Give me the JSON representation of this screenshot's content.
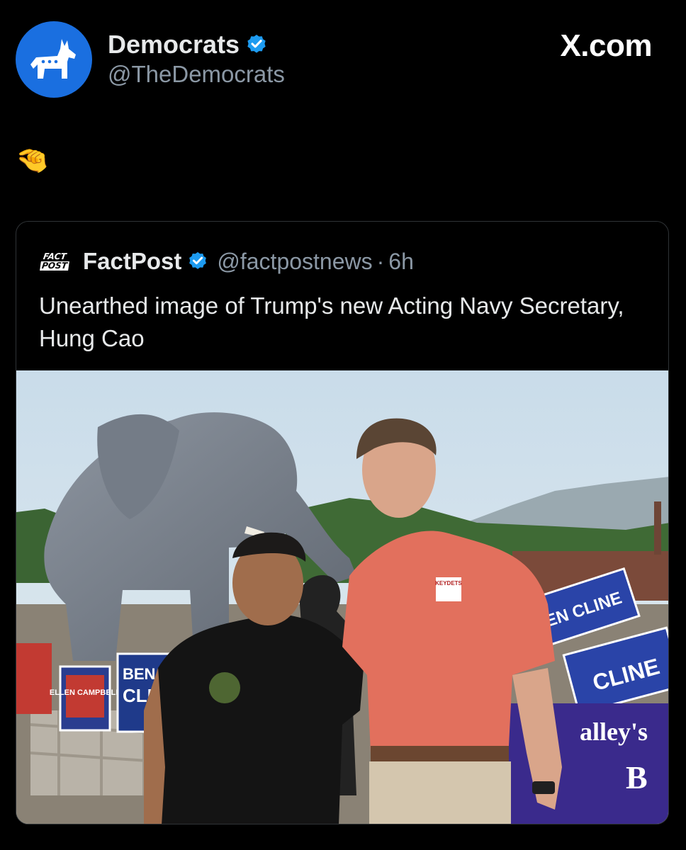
{
  "post": {
    "author": {
      "name": "Democrats",
      "handle": "@TheDemocrats",
      "verified": true,
      "avatar_icon": "donkey-icon",
      "avatar_color": "#1a6fe0"
    },
    "site_label": "X.com",
    "text": "🤏"
  },
  "quoted_post": {
    "author": {
      "name": "FactPost",
      "handle": "@factpostnews",
      "verified": true,
      "avatar_text_top": "FACT",
      "avatar_text_bottom": "POST"
    },
    "separator": "·",
    "time": "6h",
    "text": "Unearthed image of Trump's new Acting Navy Secretary, Hung Cao",
    "media": {
      "signs": {
        "sign_left_small": "ELLEN CAMPBELL",
        "sign_ben_cline_top": "BEN",
        "sign_ben_cline_bottom": "CLIN",
        "sign_right_top": "EN CLINE",
        "sign_right_bottom": "CLINE",
        "banner_top": "alley's",
        "banner_bottom": "B",
        "shirt_logo": "KEYDETS"
      }
    }
  },
  "colors": {
    "background": "#000000",
    "text_primary": "#e7e9ea",
    "text_secondary": "#8b98a5",
    "verified_blue": "#1d9bf0",
    "card_border": "#2f3336"
  }
}
